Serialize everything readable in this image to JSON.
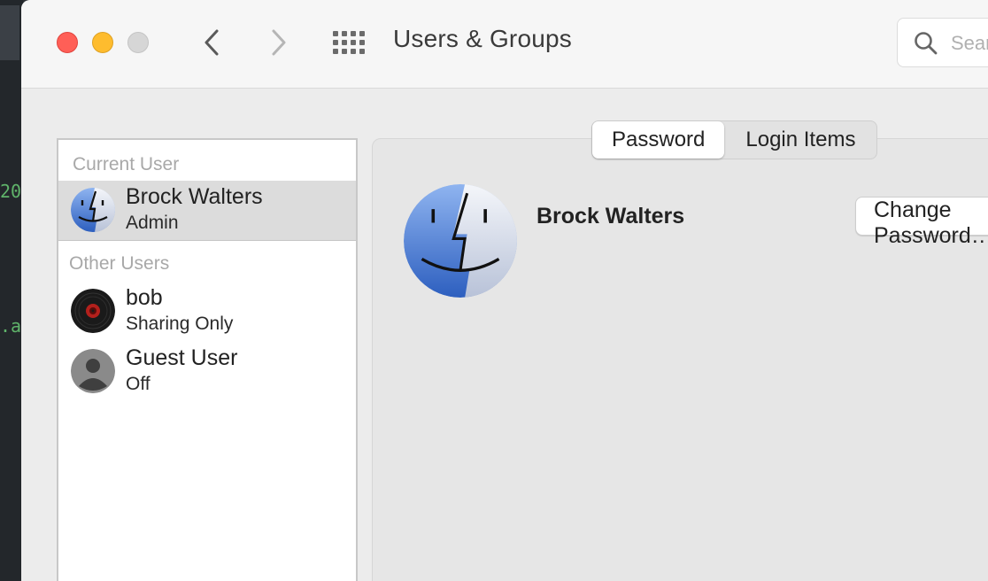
{
  "terminal": {
    "lines": [
      "20",
      ".a"
    ]
  },
  "window": {
    "title": "Users & Groups"
  },
  "toolbar": {
    "back_icon": "chevron-left-icon",
    "forward_icon": "chevron-right-icon",
    "grid_icon": "grid-icon"
  },
  "search": {
    "placeholder": "Search"
  },
  "sidebar": {
    "current_section": "Current User",
    "other_section": "Other Users",
    "current_user": {
      "name": "Brock Walters",
      "role": "Admin"
    },
    "other_users": [
      {
        "name": "bob",
        "role": "Sharing Only"
      },
      {
        "name": "Guest User",
        "role": "Off"
      }
    ]
  },
  "tabs": [
    {
      "label": "Password",
      "active": true
    },
    {
      "label": "Login Items",
      "active": false
    }
  ],
  "main": {
    "user_name": "Brock Walters",
    "change_button": "Change Password…"
  },
  "colors": {
    "close": "#ff5f57",
    "minimize": "#febc2e",
    "zoom": "#d6d6d6",
    "selection": "#dcdcdc"
  }
}
